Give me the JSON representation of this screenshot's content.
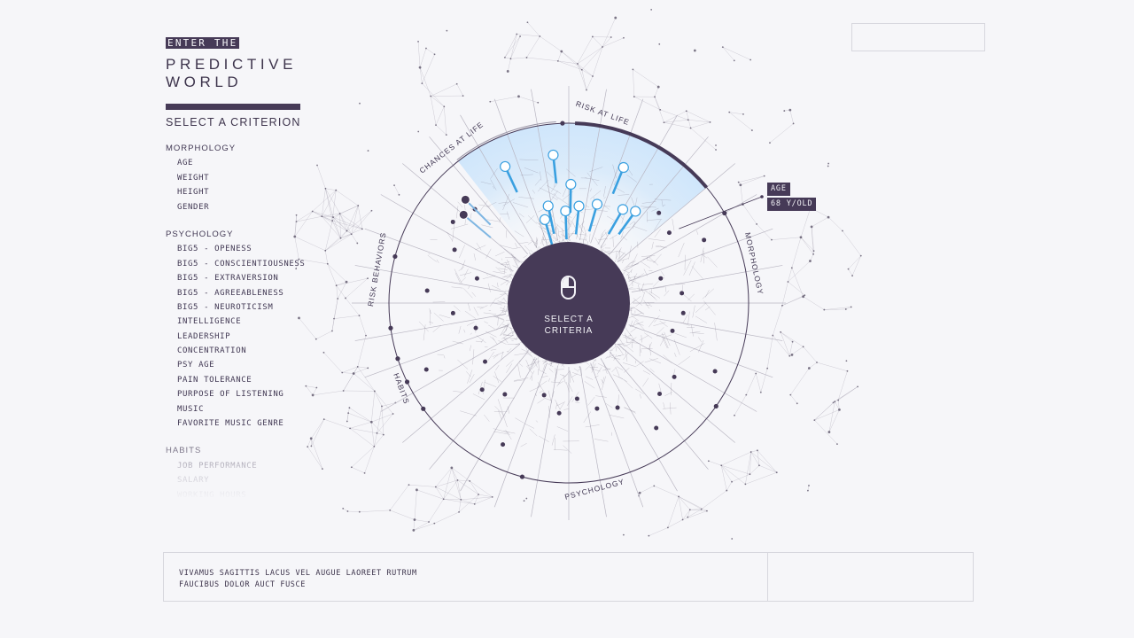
{
  "header": {
    "kicker": "ENTER THE",
    "title_line1": "PREDICTIVE",
    "title_line2": "WORLD"
  },
  "sidebar": {
    "heading": "SELECT A CRITERION",
    "groups": [
      {
        "label": "MORPHOLOGY",
        "items": [
          "AGE",
          "WEIGHT",
          "HEIGHT",
          "GENDER"
        ]
      },
      {
        "label": "PSYCHOLOGY",
        "items": [
          "BIG5 - OPENESS",
          "BIG5 - CONSCIENTIOUSNESS",
          "BIG5 - EXTRAVERSION",
          "BIG5 - AGREEABLENESS",
          "BIG5 - NEUROTICISM",
          "INTELLIGENCE",
          "LEADERSHIP",
          "CONCENTRATION",
          "PSY AGE",
          "PAIN TOLERANCE",
          "PURPOSE OF LISTENING",
          "MUSIC",
          "FAVORITE MUSIC GENRE"
        ]
      },
      {
        "label": "HABITS",
        "items": [
          "JOB PERFORMANCE",
          "SALARY",
          "WORKING HOURS"
        ]
      }
    ]
  },
  "wheel": {
    "segment_labels": [
      "RISK AT LIFE",
      "MORPHOLOGY",
      "PSYCHOLOGY",
      "HABITS",
      "RISK BEHAVIORS",
      "CHANCES AT LIFE"
    ],
    "highlight_color": "#cfe6fb",
    "accent_color": "#3aa0e0",
    "dark_color": "#463a57"
  },
  "tooltip": {
    "label": "AGE",
    "value": "68 Y/OLD"
  },
  "center_button": {
    "line1": "SELECT A",
    "line2": "CRITERIA",
    "icon": "mouse-icon"
  },
  "bottom_panel": {
    "line1": "VIVAMUS SAGITTIS LACUS VEL AUGUE LAOREET RUTRUM",
    "line2": "FAUCIBUS DOLOR AUCT FUSCE"
  }
}
